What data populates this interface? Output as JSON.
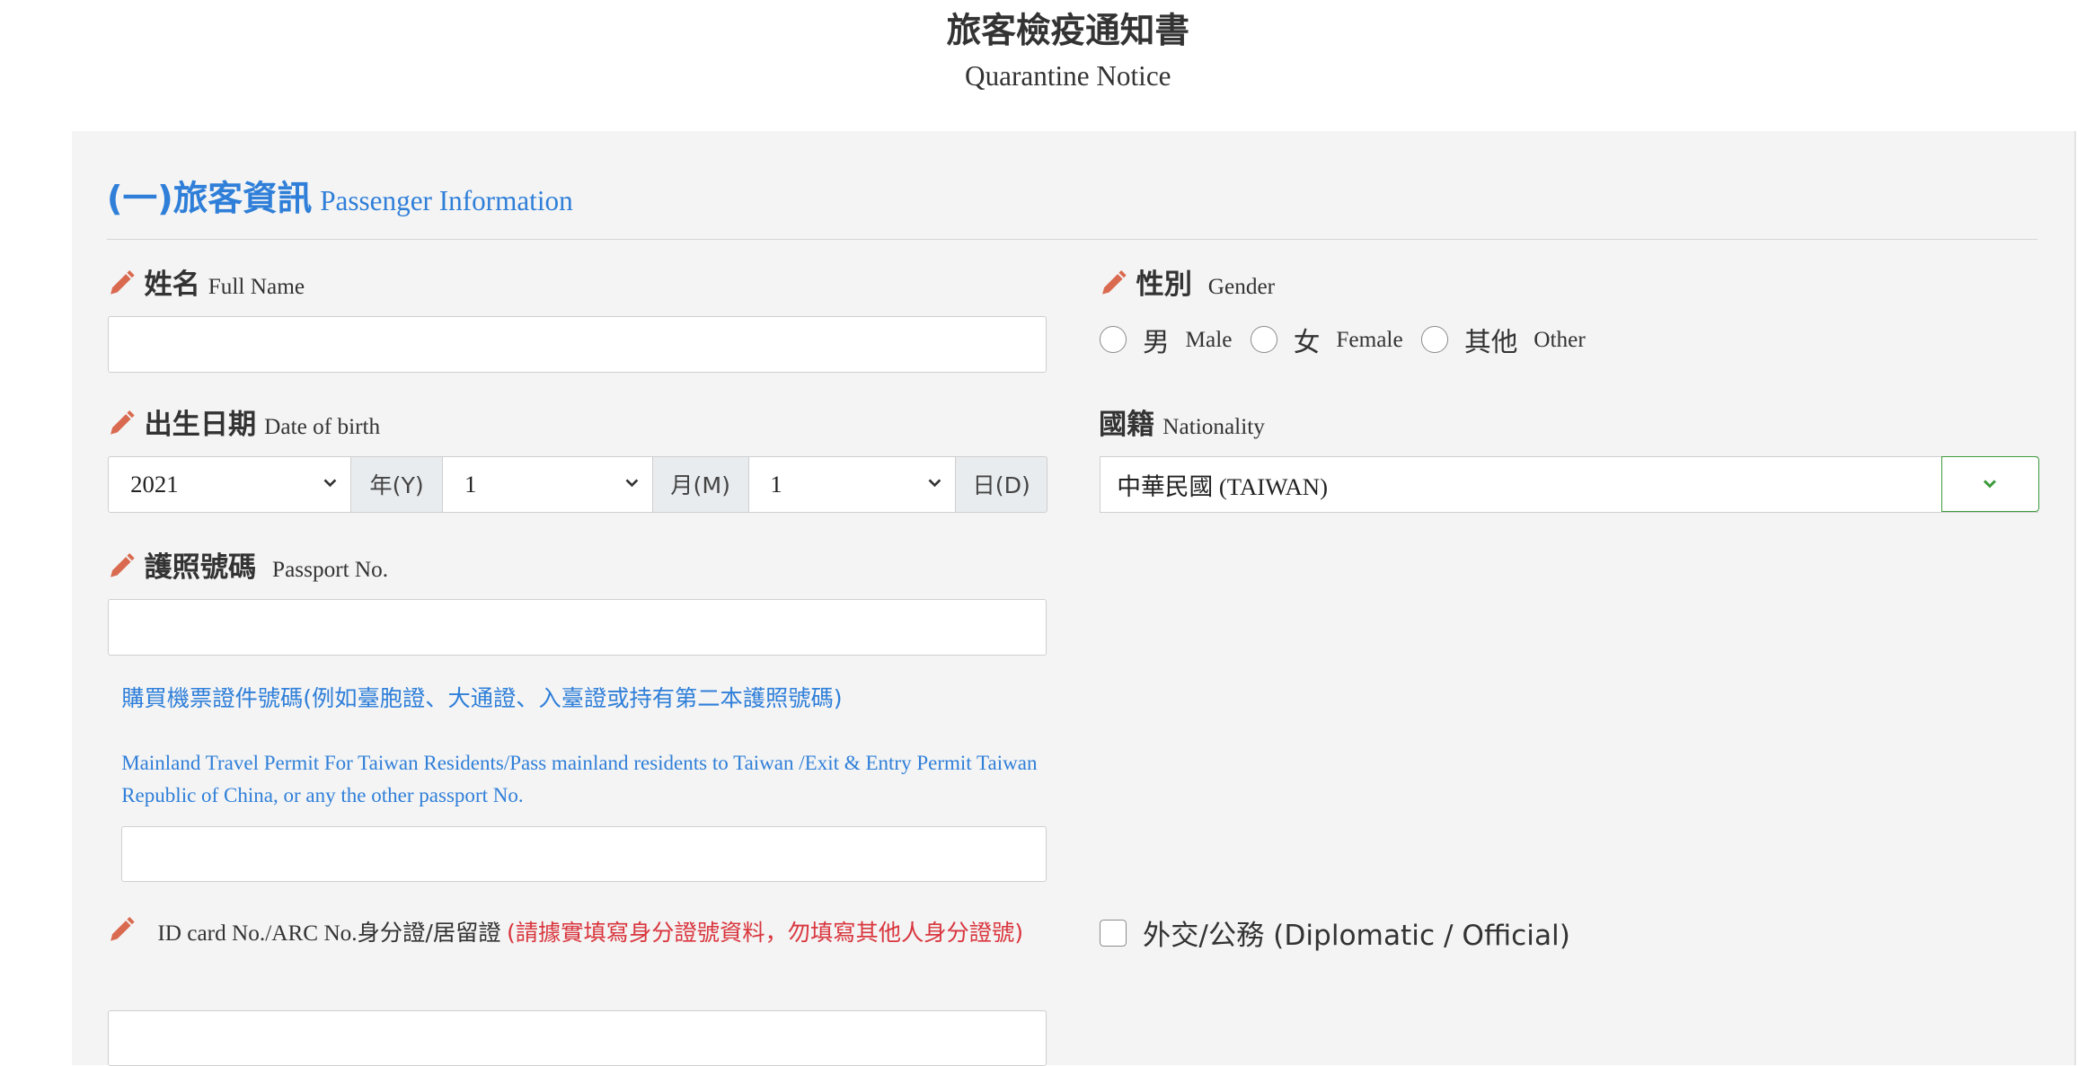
{
  "header": {
    "title_zh": "旅客檢疫通知書",
    "title_en": "Quarantine Notice"
  },
  "section": {
    "title_zh": "(一)旅客資訊",
    "title_en": "Passenger Information"
  },
  "full_name": {
    "label_zh": "姓名",
    "label_en": "Full Name",
    "value": ""
  },
  "gender": {
    "label_zh": "性別",
    "label_en": "Gender",
    "options": [
      {
        "zh": "男",
        "en": "Male"
      },
      {
        "zh": "女",
        "en": "Female"
      },
      {
        "zh": "其他",
        "en": "Other"
      }
    ]
  },
  "dob": {
    "label_zh": "出生日期",
    "label_en": "Date of birth",
    "year": "2021",
    "year_unit": "年(Y)",
    "month": "1",
    "month_unit": "月(M)",
    "day": "1",
    "day_unit": "日(D)"
  },
  "nationality": {
    "label_zh": "國籍",
    "label_en": "Nationality",
    "value": "中華民國 (TAIWAN)"
  },
  "passport": {
    "label_zh": "護照號碼",
    "label_en": "Passport No.",
    "value": ""
  },
  "alt_document": {
    "note_zh": "購買機票證件號碼(例如臺胞證、大通證、入臺證或持有第二本護照號碼)",
    "note_en": "Mainland Travel Permit For Taiwan Residents/Pass mainland residents to Taiwan /Exit & Entry Permit Taiwan Republic of China, or any the other passport No.",
    "value": ""
  },
  "id_card": {
    "label_en": "ID card No./ARC No.",
    "label_zh": "身分證/居留證",
    "warning": "(請據實填寫身分證號資料，勿填寫其他人身分證號)",
    "value": ""
  },
  "diplomatic": {
    "label": "外交/公務 (Diplomatic / Official)",
    "checked": false
  },
  "colors": {
    "accent": "#2f7fd9",
    "pencil": "#d96a4f",
    "warning": "#d9363e",
    "nat_button": "#3c9a3c"
  },
  "icons": {
    "pencil": "pencil-icon",
    "chevron": "chevron-down-icon"
  }
}
